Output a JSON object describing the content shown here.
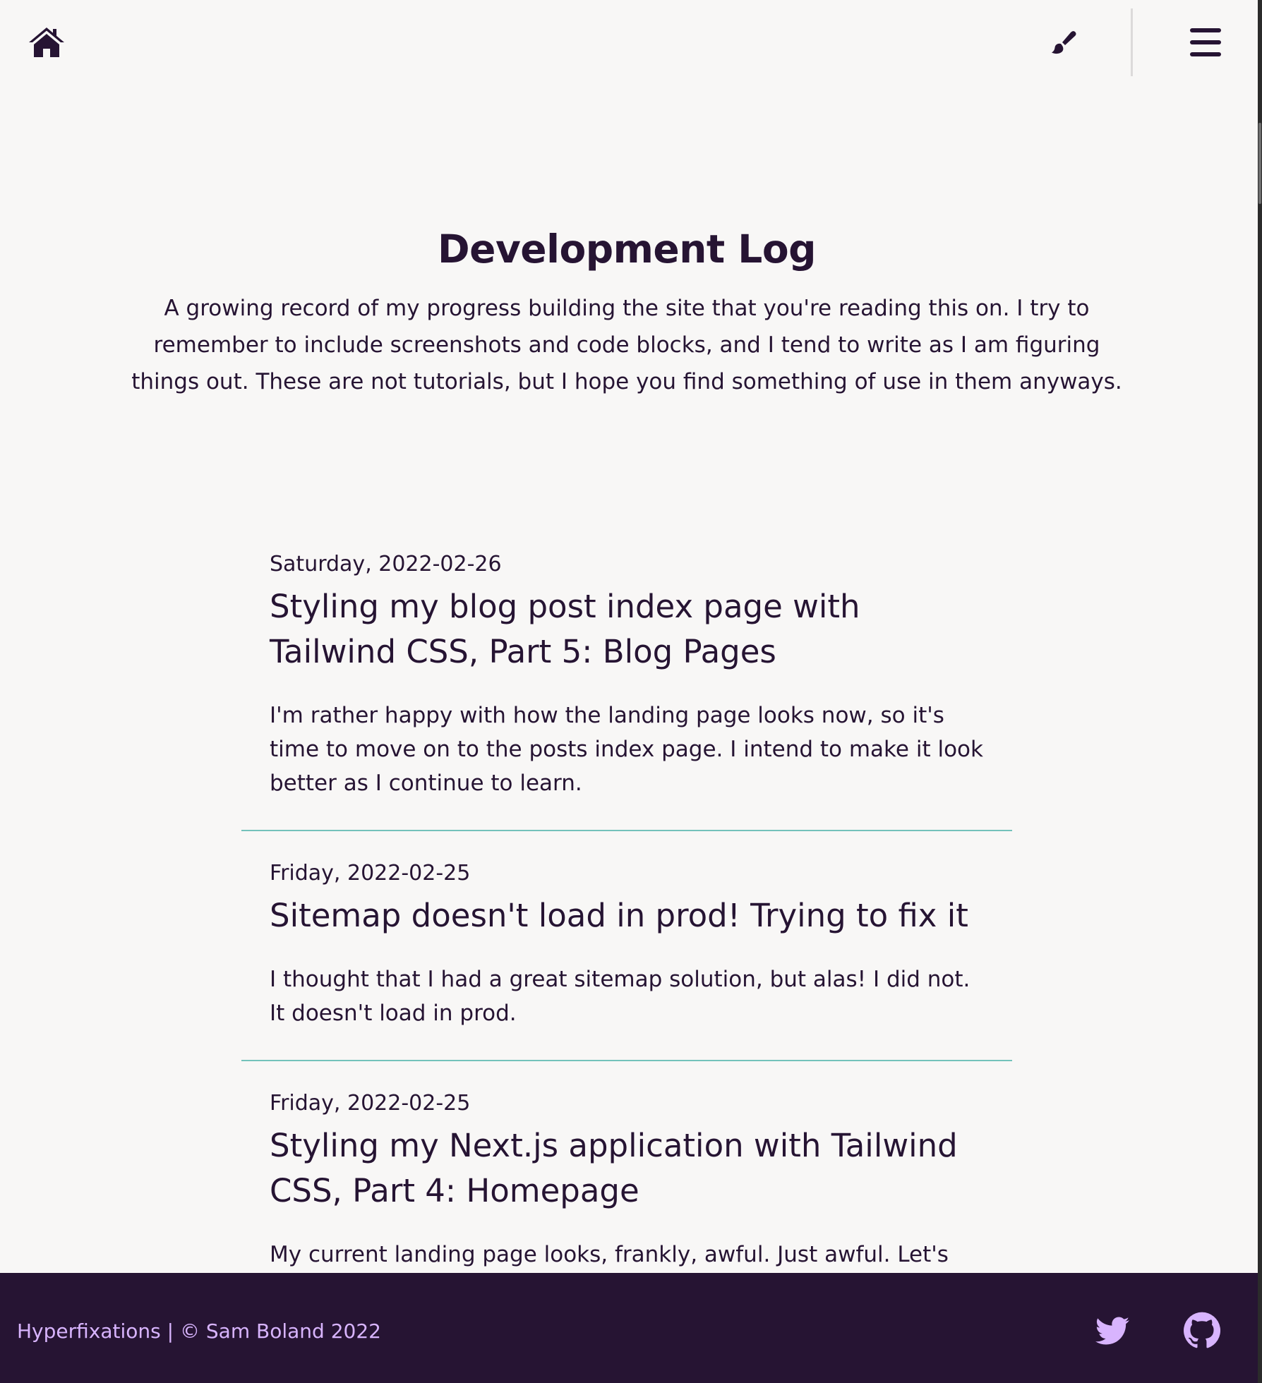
{
  "nav": {
    "home_icon": "home-icon",
    "theme_icon": "paintbrush-icon",
    "menu_icon": "hamburger-menu-icon"
  },
  "hero": {
    "title": "Development Log",
    "description": "A growing record of my progress building the site that you're reading this on. I try to remember to include screenshots and code blocks, and I tend to write as I am figuring things out. These are not tutorials, but I hope you find something of use in them anyways."
  },
  "posts": [
    {
      "date": "Saturday, 2022-02-26",
      "title": "Styling my blog post index page with Tailwind CSS, Part 5: Blog Pages",
      "excerpt": "I'm rather happy with how the landing page looks now, so it's time to move on to the posts index page. I intend to make it look better as I continue to learn."
    },
    {
      "date": "Friday, 2022-02-25",
      "title": "Sitemap doesn't load in prod! Trying to fix it",
      "excerpt": "I thought that I had a great sitemap solution, but alas! I did not. It doesn't load in prod."
    },
    {
      "date": "Friday, 2022-02-25",
      "title": "Styling my Next.js application with Tailwind CSS, Part 4: Homepage",
      "excerpt": "My current landing page looks, frankly, awful. Just awful. Let's figure"
    }
  ],
  "footer": {
    "site_name": "Hyperfixations",
    "separator": "|",
    "copyright": "© Sam Boland 2022",
    "twitter_icon": "twitter-icon",
    "github_icon": "github-icon"
  },
  "colors": {
    "background": "#f8f7f6",
    "text": "#261433",
    "divider": "#74c2bb",
    "footer_bg": "#261433",
    "footer_text": "#d8b4fe"
  }
}
